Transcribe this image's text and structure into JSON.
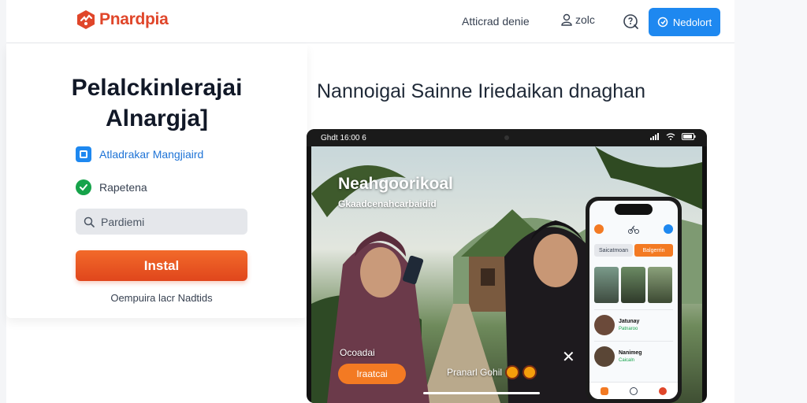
{
  "header": {
    "logo_text": "Pnardpia",
    "nav_link": "Atticrad denie",
    "user_label": "zolc",
    "primary_button": "Nedolort",
    "brand_color": "#e0462a",
    "accent_color": "#1e88f0"
  },
  "hero": {
    "title_line1": "Pelalckinlerajai",
    "title_line2": "Alnargja]",
    "features": [
      {
        "label": "Atladrakar Mangjiaird",
        "icon": "app-square-icon"
      },
      {
        "label": "Rapetena",
        "icon": "check-circle-icon"
      }
    ],
    "search_value": "Pardiemi",
    "install_label": "Instal",
    "install_color": "#f26a2a",
    "footnote": "Oempuira lacr Nadtids"
  },
  "section_title": "Nannoigai Sainne Iriedaikan dnaghan",
  "tablet": {
    "status_left": "Ghdt 16:00 6",
    "scene_title": "Neahgoorikoal",
    "scene_subtitle": "Gkaadcenahcarbaidid",
    "scene_small": "Ocoadai",
    "scene_button": "Iraatcai",
    "scene_meta": "Pranarl Gohil"
  },
  "phone": {
    "tabs": [
      "Saicatmoan",
      "Balgerrin"
    ],
    "items": [
      {
        "name": "Jatunay",
        "tag": "Patnaroo"
      },
      {
        "name": "Nanimeg",
        "tag": "Caicaln"
      }
    ]
  }
}
